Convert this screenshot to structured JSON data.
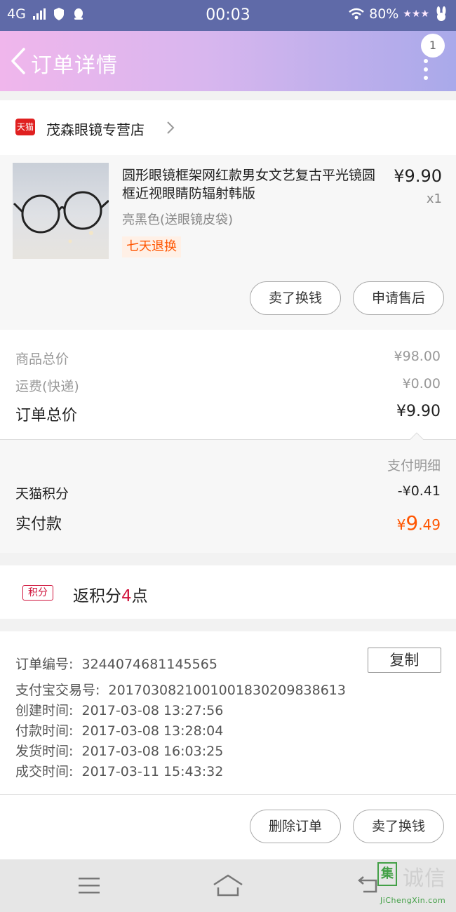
{
  "status_bar": {
    "network": "4G",
    "time": "00:03",
    "battery": "80%"
  },
  "header": {
    "title": "订单详情",
    "more_badge": "1"
  },
  "shop": {
    "platform_badge": "天猫",
    "name": "茂森眼镜专营店"
  },
  "product": {
    "name": "圆形眼镜框架网红款男女文艺复古平光镜圆框近视眼睛防辐射韩版",
    "price": "¥9.90",
    "quantity": "x1",
    "sku": "亮黑色(送眼镜皮袋)",
    "service_tag": "七天退换",
    "buttons": [
      "卖了换钱",
      "申请售后"
    ]
  },
  "summary": {
    "goods_total_label": "商品总价",
    "goods_total_value": "¥98.00",
    "shipping_label": "运费(快递)",
    "shipping_value": "¥0.00",
    "order_total_label": "订单总价",
    "order_total_value": "¥9.90"
  },
  "payment": {
    "details_label": "支付明细",
    "points_label": "天猫积分",
    "points_value": "-¥0.41",
    "paid_label": "实付款",
    "paid_currency": "¥",
    "paid_int": "9",
    "paid_dec": ".49"
  },
  "rewards": {
    "badge": "积分",
    "text_prefix": "返积分",
    "points": "4",
    "text_suffix": "点"
  },
  "order_info": {
    "order_no_label": "订单编号:",
    "order_no": "3244074681145565",
    "copy_label": "复制",
    "alipay_label": "支付宝交易号:",
    "alipay_no": "2017030821001001830209838613",
    "created_label": "创建时间:",
    "created": "2017-03-08 13:27:56",
    "paid_label": "付款时间:",
    "paid": "2017-03-08 13:28:04",
    "shipped_label": "发货时间:",
    "shipped": "2017-03-08 16:03:25",
    "completed_label": "成交时间:",
    "completed": "2017-03-11 15:43:32"
  },
  "footer_actions": [
    "删除订单",
    "卖了换钱"
  ],
  "watermark": {
    "box": "集",
    "text": "诚信",
    "sub": "JiChengXin.com"
  },
  "colors": {
    "status_bar": "#5f6aa8",
    "header_gradient_start": "#f0b6ec",
    "header_gradient_end": "#a9a9ea",
    "accent_orange": "#ff5500",
    "accent_red": "#d0143c"
  },
  "icons": [
    "back-icon",
    "more-icon",
    "tmall-icon",
    "chevron-right-icon",
    "menu-icon",
    "home-icon",
    "back-nav-icon"
  ]
}
